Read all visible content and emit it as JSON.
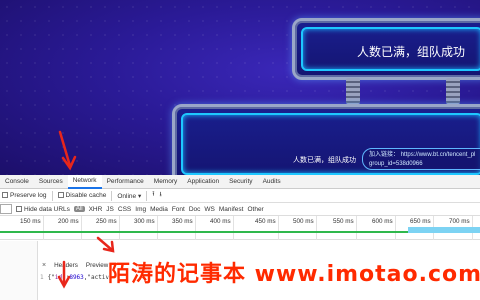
{
  "banner": {
    "sign_top_text": "人数已满，组队成功",
    "sign_bottom_text": "人数已满，组队成功",
    "join_label": "加入链接：",
    "join_url": "https://www.bt.cn/tencent_pl",
    "join_group": "group_id=538d0966"
  },
  "devtools": {
    "tabs": [
      "Console",
      "Sources",
      "Network",
      "Performance",
      "Memory",
      "Application",
      "Security",
      "Audits"
    ],
    "active_tab": "Network",
    "toolbar1": {
      "preserve_log": "Preserve log",
      "disable_cache": "Disable cache",
      "online": "Online"
    },
    "toolbar2": {
      "hide_data_urls": "Hide data URLs",
      "all_badge": "All",
      "filters": [
        "XHR",
        "JS",
        "CSS",
        "Img",
        "Media",
        "Font",
        "Doc",
        "WS",
        "Manifest",
        "Other"
      ]
    },
    "timeline_ticks": [
      "150 ms",
      "200 ms",
      "250 ms",
      "300 ms",
      "350 ms",
      "400 ms",
      "450 ms",
      "500 ms",
      "550 ms",
      "600 ms",
      "650 ms",
      "700 ms"
    ],
    "detail_tabs": [
      "Headers",
      "Preview"
    ],
    "close_symbol": "×",
    "json_line_number": "1",
    "json_preview_prefix": "{\"",
    "json_key": "id",
    "json_colon": "\":",
    "json_value": "8963",
    "json_rest": ",\"activ"
  },
  "watermark": "陌涛的记事本 www.imotao.com"
}
